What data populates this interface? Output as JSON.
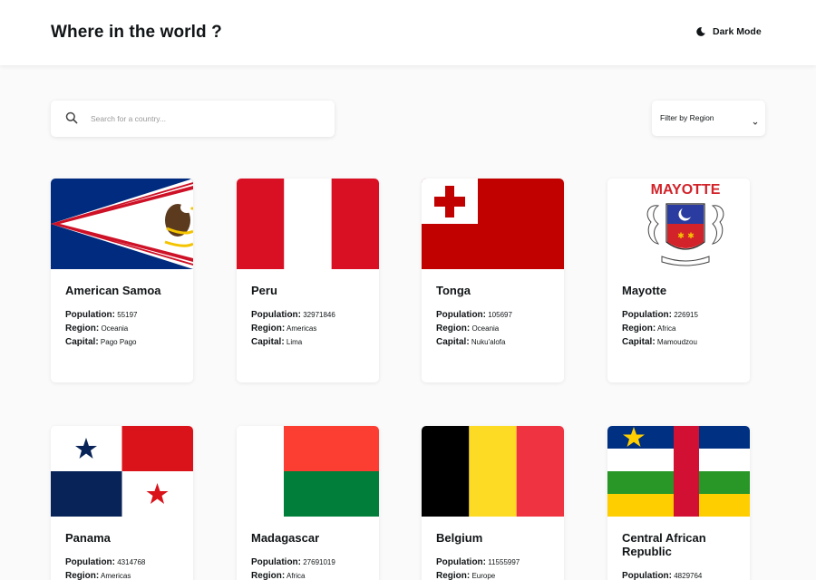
{
  "header": {
    "title": "Where in the world ?",
    "theme_toggle_label": "Dark Mode"
  },
  "search": {
    "placeholder": "Search for a country..."
  },
  "filter": {
    "label": "Filter by Region"
  },
  "detail_labels": {
    "population": "Population:",
    "region": "Region:",
    "capital": "Capital:"
  },
  "countries": [
    {
      "name": "American Samoa",
      "population": "55197",
      "region": "Oceania",
      "capital": "Pago Pago"
    },
    {
      "name": "Peru",
      "population": "32971846",
      "region": "Americas",
      "capital": "Lima"
    },
    {
      "name": "Tonga",
      "population": "105697",
      "region": "Oceania",
      "capital": "Nuku'alofa"
    },
    {
      "name": "Mayotte",
      "population": "226915",
      "region": "Africa",
      "capital": "Mamoudzou",
      "flag_text": "MAYOTTE"
    },
    {
      "name": "Panama",
      "population": "4314768",
      "region": "Americas",
      "capital": ""
    },
    {
      "name": "Madagascar",
      "population": "27691019",
      "region": "Africa",
      "capital": ""
    },
    {
      "name": "Belgium",
      "population": "11555997",
      "region": "Europe",
      "capital": ""
    },
    {
      "name": "Central African Republic",
      "population": "4829764",
      "region": "",
      "capital": ""
    }
  ],
  "colors": {
    "background": "#fafafa",
    "card": "#ffffff",
    "text": "#111517"
  }
}
